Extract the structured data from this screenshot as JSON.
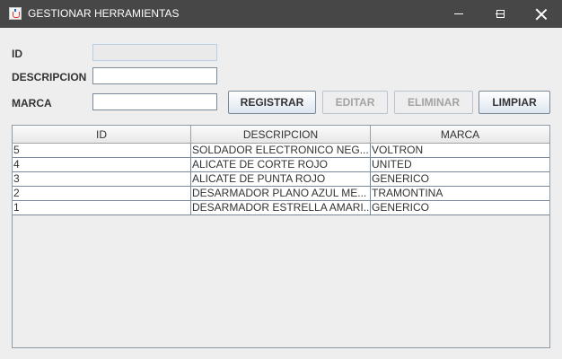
{
  "window": {
    "title": "GESTIONAR HERRAMIENTAS"
  },
  "form": {
    "id_label": "ID",
    "id_value": "",
    "descripcion_label": "DESCRIPCION",
    "descripcion_value": "",
    "marca_label": "MARCA",
    "marca_value": ""
  },
  "buttons": {
    "registrar": "REGISTRAR",
    "editar": "EDITAR",
    "eliminar": "ELIMINAR",
    "limpiar": "LIMPIAR"
  },
  "table": {
    "headers": [
      "ID",
      "DESCRIPCION",
      "MARCA"
    ],
    "rows": [
      [
        "5",
        "SOLDADOR ELECTRONICO NEG...",
        "VOLTRON"
      ],
      [
        "4",
        "ALICATE DE CORTE ROJO",
        "UNITED"
      ],
      [
        "3",
        "ALICATE DE PUNTA ROJO",
        "GENERICO"
      ],
      [
        "2",
        "DESARMADOR PLANO AZUL ME...",
        "TRAMONTINA"
      ],
      [
        "1",
        "DESARMADOR ESTRELLA AMARI...",
        "GENERICO"
      ]
    ]
  },
  "colors": {
    "titlebar": "#474747",
    "background": "#eeeeee"
  },
  "icons": [
    "java-app-icon",
    "minimize-icon",
    "maximize-icon",
    "close-icon"
  ]
}
